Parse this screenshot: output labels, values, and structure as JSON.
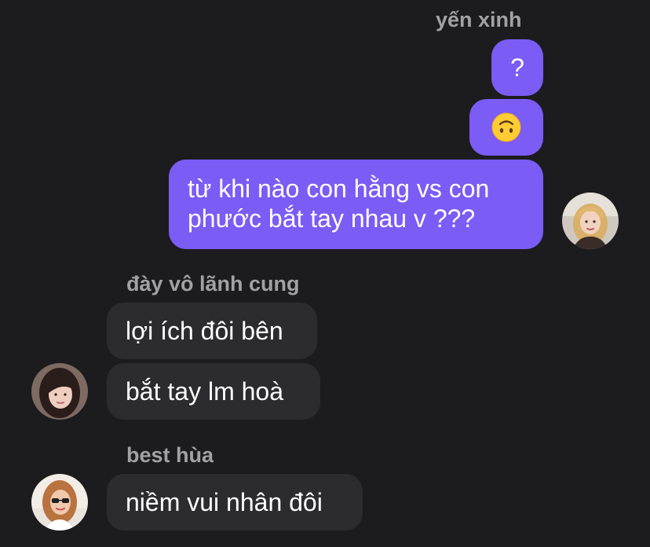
{
  "colors": {
    "background": "#1c1c1e",
    "outgoing_bubble": "#7b5cf5",
    "incoming_bubble": "#2c2c2e",
    "sender_name": "#a1a1a6",
    "message_text": "#ffffff"
  },
  "messages": {
    "sender_self": "yến xinh",
    "out_1": "?",
    "out_2_emoji": "upside-down-face",
    "out_3_line1": "từ khi nào con hằng vs con",
    "out_3_line2": "phước bắt tay nhau v ???",
    "sender_2": "đày vô lãnh cung",
    "in_1": "lợi ích đôi bên",
    "in_2": "bắt tay lm hoà",
    "sender_3": "best hùa",
    "in_3": "niềm vui nhân đôi"
  },
  "icons": {
    "emoji": "upside-down-face-emoji",
    "avatar_self": "user-avatar-blonde",
    "avatar_2": "user-avatar-dark-hair",
    "avatar_3": "user-avatar-sunglasses"
  }
}
